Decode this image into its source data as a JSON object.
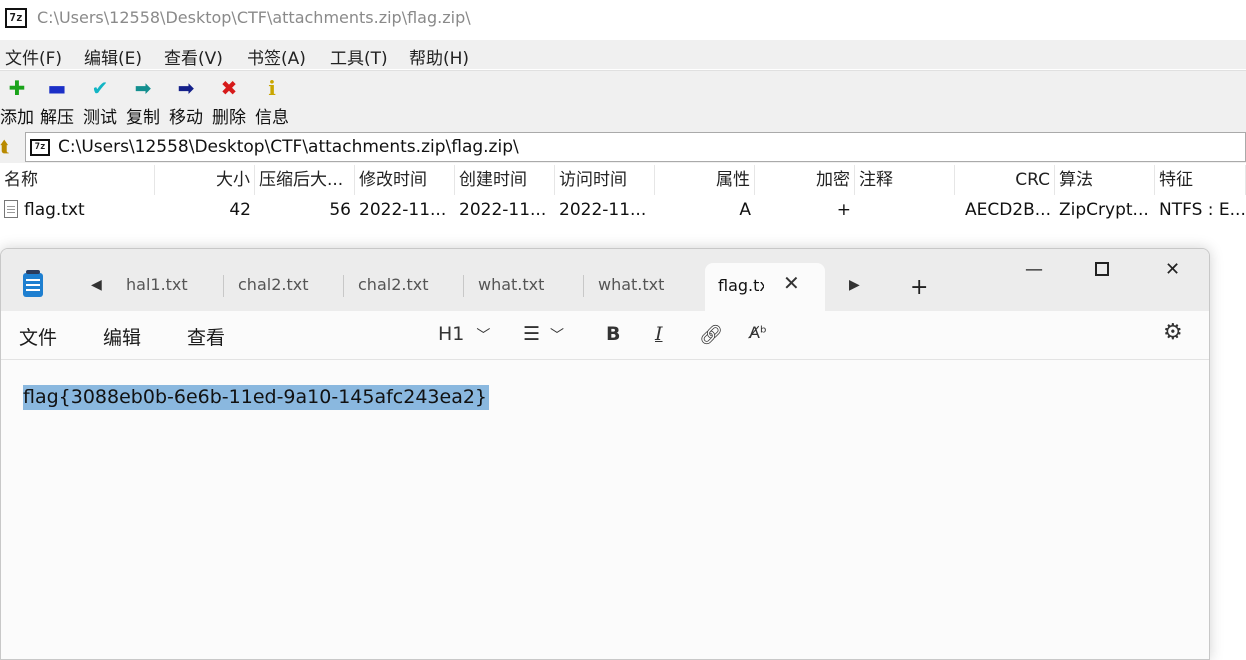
{
  "sevenzip": {
    "title": "C:\\Users\\12558\\Desktop\\CTF\\attachments.zip\\flag.zip\\",
    "logo": "7z",
    "menu": [
      "文件(F)",
      "编辑(E)",
      "查看(V)",
      "书签(A)",
      "工具(T)",
      "帮助(H)"
    ],
    "toolbar": [
      {
        "label": "添加",
        "icon": "add-plus-icon",
        "glyph": "✚",
        "color": "#1aa31a"
      },
      {
        "label": "解压",
        "icon": "extract-minus-icon",
        "glyph": "▬",
        "color": "#1b2fc7"
      },
      {
        "label": "测试",
        "icon": "test-check-icon",
        "glyph": "✔",
        "color": "#12b5c4"
      },
      {
        "label": "复制",
        "icon": "copy-arrow-icon",
        "glyph": "➡",
        "color": "#138f8f"
      },
      {
        "label": "移动",
        "icon": "move-arrow-icon",
        "glyph": "➡",
        "color": "#14208a"
      },
      {
        "label": "删除",
        "icon": "delete-x-icon",
        "glyph": "✖",
        "color": "#d61a1a"
      },
      {
        "label": "信息",
        "icon": "info-icon",
        "glyph": "i",
        "color": "#c9a600"
      }
    ],
    "address": "C:\\Users\\12558\\Desktop\\CTF\\attachments.zip\\flag.zip\\",
    "columns": [
      "名称",
      "大小",
      "压缩后大...",
      "修改时间",
      "创建时间",
      "访问时间",
      "属性",
      "加密",
      "注释",
      "CRC",
      "算法",
      "特征"
    ],
    "rows": [
      {
        "name": "flag.txt",
        "size": "42",
        "packed": "56",
        "modified": "2022-11...",
        "created": "2022-11...",
        "accessed": "2022-11...",
        "attr": "A",
        "encrypted": "+",
        "comment": "",
        "crc": "AECD2B...",
        "method": "ZipCrypt...",
        "characteristics": "NTFS : E..."
      }
    ]
  },
  "notepad": {
    "tabs": [
      "hal1.txt",
      "chal2.txt",
      "chal2.txt",
      "what.txt",
      "what.txt"
    ],
    "active_tab": "flag.txt",
    "menu": [
      "文件",
      "编辑",
      "查看"
    ],
    "format": {
      "heading": "H1",
      "bold": "B",
      "italic": "I"
    },
    "content": "flag{3088eb0b-6e6b-11ed-9a10-145afc243ea2}"
  }
}
